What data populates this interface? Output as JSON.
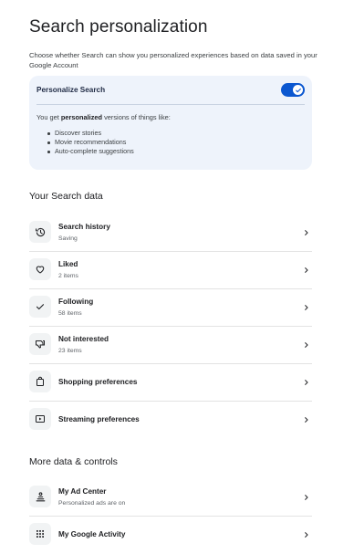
{
  "page": {
    "title": "Search personalization",
    "intro": "Choose whether Search can show you personalized experiences based on data saved in your Google Account"
  },
  "personalize_card": {
    "title": "Personalize Search",
    "toggle_on": true,
    "desc_prefix": "You get ",
    "desc_bold": "personalized",
    "desc_suffix": " versions of things like:",
    "bullets": [
      "Discover stories",
      "Movie recommendations",
      "Auto-complete suggestions"
    ]
  },
  "search_data": {
    "heading": "Your Search data",
    "items": [
      {
        "title": "Search history",
        "subtitle": "Saving",
        "icon": "history-icon"
      },
      {
        "title": "Liked",
        "subtitle": "2 items",
        "icon": "heart-icon"
      },
      {
        "title": "Following",
        "subtitle": "58 items",
        "icon": "check-icon"
      },
      {
        "title": "Not interested",
        "subtitle": "23 items",
        "icon": "thumb-down-icon"
      },
      {
        "title": "Shopping preferences",
        "subtitle": "",
        "icon": "shopping-bag-icon"
      },
      {
        "title": "Streaming preferences",
        "subtitle": "",
        "icon": "play-box-icon"
      }
    ]
  },
  "more_controls": {
    "heading": "More data & controls",
    "items": [
      {
        "title": "My Ad Center",
        "subtitle": "Personalized ads are on",
        "icon": "ad-center-icon"
      },
      {
        "title": "My Google Activity",
        "subtitle": "",
        "icon": "grid-icon"
      }
    ]
  },
  "colors": {
    "accent": "#0b57d0",
    "card_bg": "#eef3fb",
    "divider": "#e3e3e3"
  }
}
